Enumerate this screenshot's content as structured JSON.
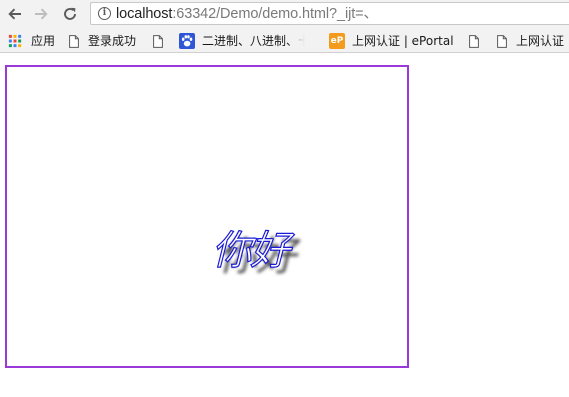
{
  "toolbar": {
    "back_icon": "arrow-left-icon",
    "forward_icon": "arrow-right-icon",
    "reload_icon": "reload-icon",
    "info_icon": "info-icon",
    "info_glyph": "i",
    "url_host": "localhost",
    "url_rest": ":63342/Demo/demo.html?_ijt=、"
  },
  "bookmarks": {
    "apps_label": "应用",
    "items": [
      {
        "label": "登录成功",
        "icon": "page-icon"
      },
      {
        "label": "",
        "icon": "page-icon"
      },
      {
        "label": "二进制、八进制、十进",
        "icon": "baidu-paw-icon"
      },
      {
        "label": "上网认证 | ePortal",
        "icon": "eportal-icon",
        "icon_text": "eP"
      },
      {
        "label": "",
        "icon": "page-icon"
      },
      {
        "label": "上网认证",
        "icon": "page-icon"
      }
    ]
  },
  "demo": {
    "text": "你好",
    "border_color": "#9a39d8",
    "stroke_color": "#1a1ad6"
  }
}
